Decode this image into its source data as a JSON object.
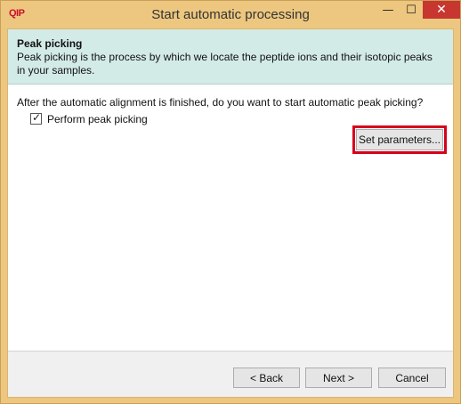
{
  "titlebar": {
    "app_icon_text": "QIP",
    "title": "Start automatic processing",
    "minimize_glyph": "—",
    "maximize_glyph": "☐",
    "close_glyph": "✕"
  },
  "header": {
    "title": "Peak picking",
    "description": "Peak picking is the process by which we locate the peptide ions and their isotopic peaks in your samples."
  },
  "body": {
    "question": "After the automatic alignment is finished, do you want to start automatic peak picking?",
    "checkbox_label": "Perform peak picking",
    "checkbox_checked": true,
    "checkbox_glyph": "✓",
    "set_parameters_label": "Set parameters..."
  },
  "footer": {
    "back_label": "< Back",
    "next_label": "Next >",
    "cancel_label": "Cancel"
  },
  "colors": {
    "titlebar_bg": "#edc77f",
    "header_bg": "#d3ebe7",
    "close_bg": "#c7372f",
    "highlight": "#d6001c"
  }
}
